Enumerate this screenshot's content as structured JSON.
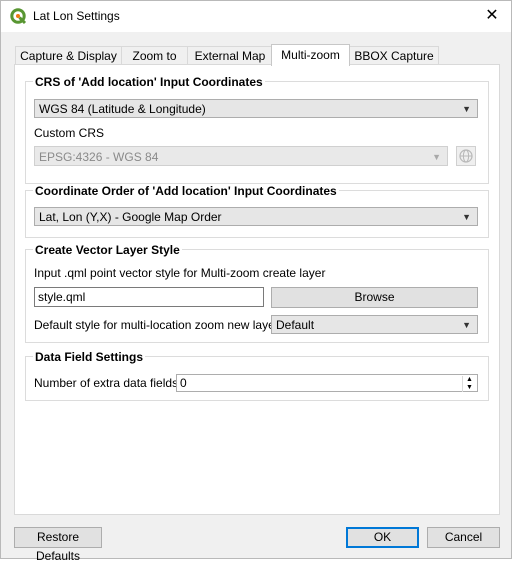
{
  "window": {
    "title": "Lat Lon Settings",
    "icon": "qgis-logo-icon",
    "close_glyph": "✕"
  },
  "tabs": [
    {
      "label": "Capture & Display",
      "active": false
    },
    {
      "label": "Zoom to",
      "active": false
    },
    {
      "label": "External Map",
      "active": false
    },
    {
      "label": "Multi-zoom",
      "active": true
    },
    {
      "label": "BBOX Capture",
      "active": false
    }
  ],
  "crs_group": {
    "title": "CRS of 'Add location' Input Coordinates",
    "selected": "WGS 84 (Latitude & Longitude)",
    "custom_crs_label": "Custom CRS",
    "custom_crs_value": "EPSG:4326 - WGS 84"
  },
  "order_group": {
    "title": "Coordinate Order of 'Add location' Input Coordinates",
    "selected": "Lat, Lon (Y,X) - Google Map Order"
  },
  "style_group": {
    "title": "Create Vector Layer Style",
    "input_label": "Input .qml point vector style for Multi-zoom create layer",
    "file_value": "style.qml",
    "browse_label": "Browse",
    "default_style_label": "Default style for multi-location zoom new layers",
    "default_style_value": "Default"
  },
  "data_group": {
    "title": "Data Field Settings",
    "extra_fields_label": "Number of extra data fields",
    "extra_fields_value": "0"
  },
  "footer": {
    "restore_label": "Restore Defaults",
    "ok_label": "OK",
    "cancel_label": "Cancel"
  },
  "colors": {
    "accent": "#0078d7",
    "qgis_green": "#589632",
    "qgis_yellow": "#ee7913"
  }
}
